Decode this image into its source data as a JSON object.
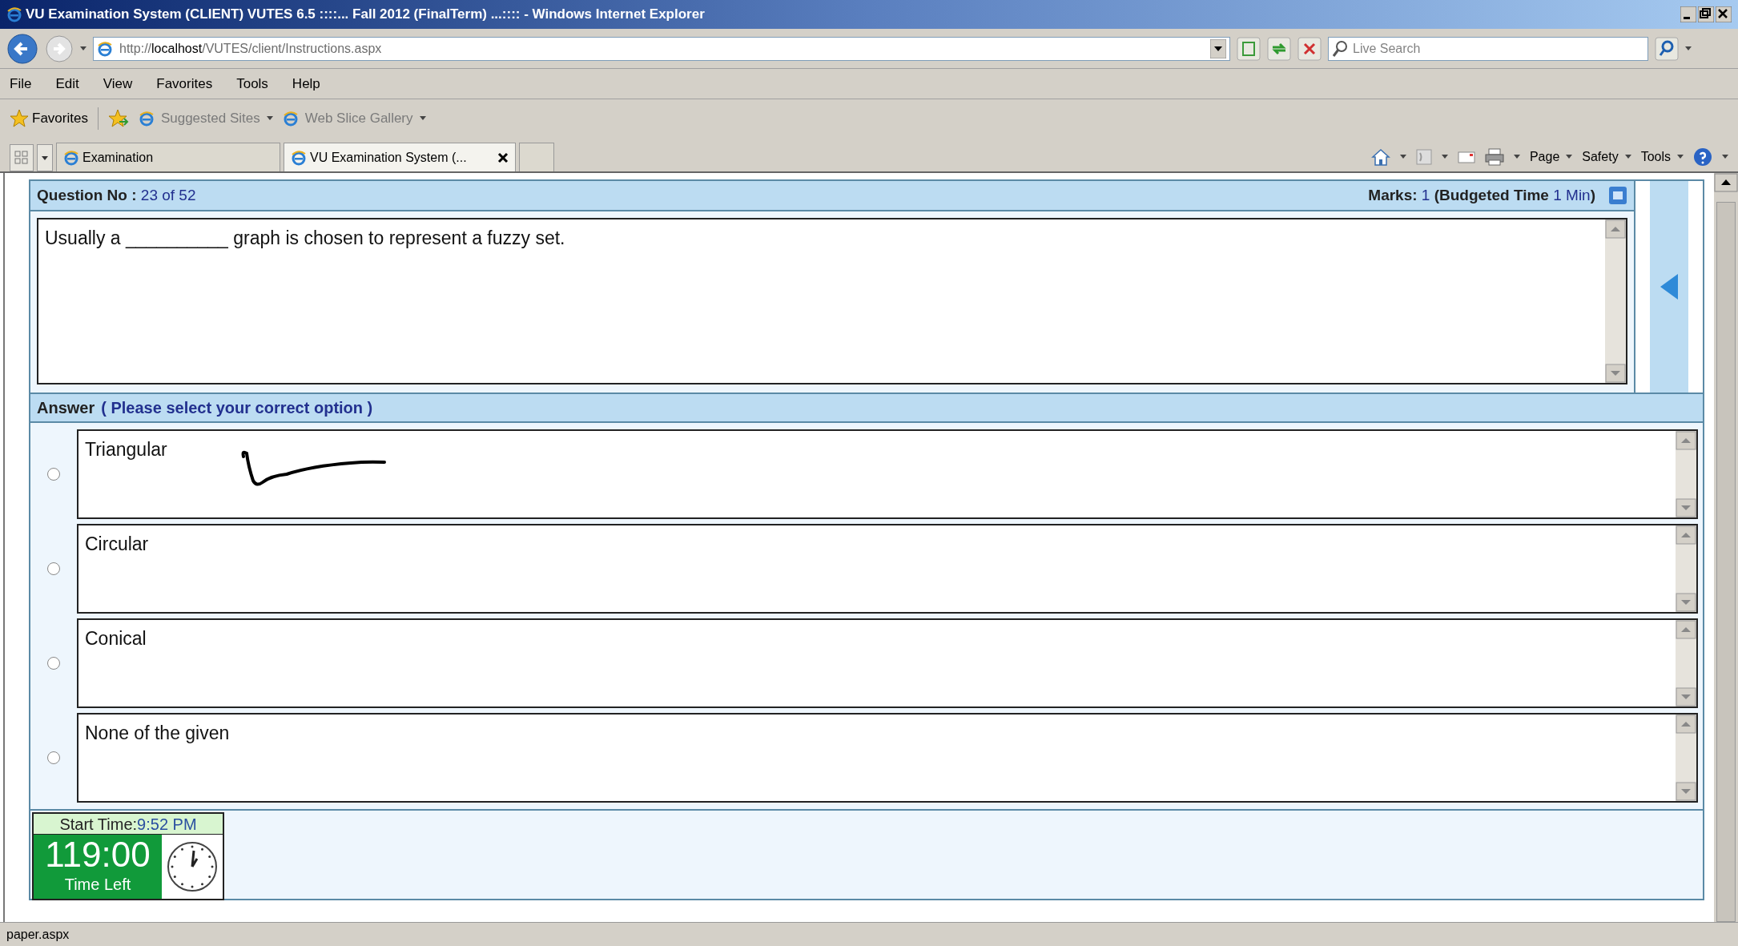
{
  "window": {
    "title": "VU Examination System (CLIENT) VUTES 6.5 ::::... Fall 2012 (FinalTerm) ...:::: - Windows Internet Explorer"
  },
  "address_bar": {
    "url_prefix": "http://",
    "url_host": "localhost",
    "url_path": "/VUTES/client/Instructions.aspx"
  },
  "search": {
    "placeholder": "Live Search"
  },
  "menu": [
    "File",
    "Edit",
    "View",
    "Favorites",
    "Tools",
    "Help"
  ],
  "favorites_bar": {
    "label": "Favorites",
    "links": [
      "Suggested Sites",
      "Web Slice Gallery"
    ]
  },
  "tabs": [
    {
      "label": "Examination",
      "selected": false
    },
    {
      "label": "VU Examination System (...",
      "selected": true
    }
  ],
  "command_bar": [
    "Page",
    "Safety",
    "Tools"
  ],
  "question": {
    "label": "Question No :",
    "number": "23 of 52",
    "marks_label": "Marks:",
    "marks": "1",
    "budget_label": "(Budgeted Time",
    "budget": "1 Min",
    "budget_end": ")",
    "text": "Usually a __________ graph is chosen to represent a fuzzy set."
  },
  "answer": {
    "label": "Answer",
    "hint": "( Please select your correct option )"
  },
  "options": [
    {
      "text": "Triangular",
      "selected": false
    },
    {
      "text": "Circular",
      "selected": false
    },
    {
      "text": "Conical",
      "selected": false
    },
    {
      "text": "None of the given",
      "selected": false
    }
  ],
  "timer": {
    "start_label": "Start Time:",
    "start": "9:52 PM",
    "remaining": "119:00",
    "remaining_label": "Time Left"
  },
  "status_bar": {
    "text": "paper.aspx"
  }
}
